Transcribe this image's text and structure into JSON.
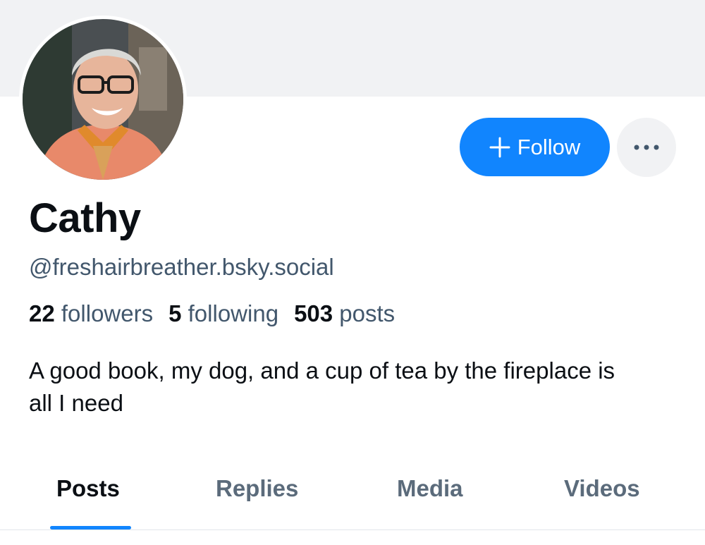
{
  "profile": {
    "display_name": "Cathy",
    "handle": "@freshairbreather.bsky.social",
    "bio": "A good book, my dog, and a cup of tea by the fireplace is all I need",
    "stats": {
      "followers_count": "22",
      "followers_label": "followers",
      "following_count": "5",
      "following_label": "following",
      "posts_count": "503",
      "posts_label": "posts"
    }
  },
  "actions": {
    "follow_label": "Follow",
    "follow_icon": "plus-icon",
    "more_icon": "ellipsis-icon"
  },
  "tabs": [
    {
      "label": "Posts",
      "active": true
    },
    {
      "label": "Replies",
      "active": false
    },
    {
      "label": "Media",
      "active": false
    },
    {
      "label": "Videos",
      "active": false
    }
  ],
  "colors": {
    "accent": "#1185fe",
    "banner": "#f1f2f4",
    "text_primary": "#0b0f14",
    "text_secondary": "#42576c"
  }
}
